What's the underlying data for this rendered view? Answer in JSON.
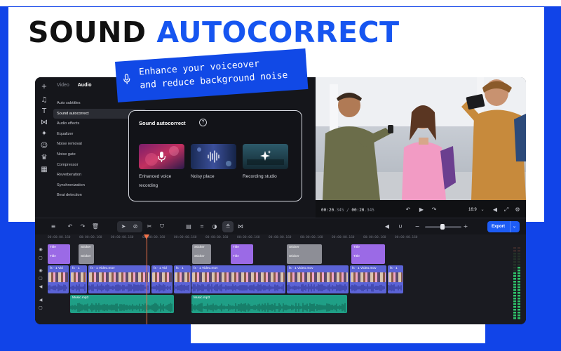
{
  "headline": {
    "word1": "SOUND",
    "word2": "AUTOCORRECT"
  },
  "callout": {
    "line1": "Enhance your voiceover",
    "line2": "and reduce background noise"
  },
  "left_panel": {
    "tabs": [
      {
        "label": "Video"
      },
      {
        "label": "Audio"
      }
    ],
    "menu": [
      {
        "label": "Auto subtitles"
      },
      {
        "label": "Sound autocorrect"
      },
      {
        "label": "Audio effects"
      },
      {
        "label": "Equalizer"
      },
      {
        "label": "Noise removal"
      },
      {
        "label": "Noise gate"
      },
      {
        "label": "Compressor"
      },
      {
        "label": "Reverberation"
      },
      {
        "label": "Synchronization"
      },
      {
        "label": "Beat detection"
      }
    ]
  },
  "sound_autocorrect": {
    "title": "Sound autocorrect",
    "help_icon": "?",
    "options": [
      {
        "label_line1": "Enhanced voice",
        "label_line2": "recording",
        "icon": "microphone-icon"
      },
      {
        "label_line1": "Noisy place",
        "label_line2": "",
        "icon": "waveform-icon"
      },
      {
        "label_line1": "Recording studio",
        "label_line2": "",
        "icon": "sparkle-icon"
      }
    ]
  },
  "preview": {
    "current_time": "00:20",
    "current_ms": ".345",
    "separator": " / ",
    "total_time": "00:20",
    "total_ms": ".345",
    "aspect_ratio": "16:9"
  },
  "toolbar": {
    "export_label": "Export"
  },
  "timeline": {
    "ruler": [
      "00:00:00.160",
      "00:00:00.160",
      "00:00:00.160",
      "00:00:00.160",
      "00:00:00.160",
      "00:00:00.160",
      "00:00:00.160",
      "00:00:00.160",
      "00:00:00.160",
      "00:00:00.160",
      "00:00:00.160",
      "00:00:00.160"
    ],
    "title_clips": [
      {
        "top": "Title",
        "bottom": "Title"
      },
      {
        "top": "Title",
        "bottom": "Title"
      },
      {
        "top": "Title",
        "bottom": "Title"
      }
    ],
    "sticker_clips": [
      {
        "top": "Sticker",
        "bottom": "Sticker"
      },
      {
        "top": "Sticker",
        "bottom": "Sticker"
      },
      {
        "top": "Sticker",
        "bottom": "Sticker"
      }
    ],
    "video_clips": [
      {
        "label": "fx · 1  Vid"
      },
      {
        "label": "fx · 1"
      },
      {
        "label": "fx · 1  Video.mov"
      },
      {
        "label": "fx · 1  Vid"
      },
      {
        "label": "fx · 1"
      },
      {
        "label": "fx · 1  Video.mov"
      },
      {
        "label": "fx · 1  Video.mov"
      },
      {
        "label": "fx · 1  Video.mov"
      },
      {
        "label": "fx · 1"
      }
    ],
    "music_clips": [
      {
        "label": "Music.mp3"
      },
      {
        "label": "Music.mp3"
      }
    ]
  },
  "colors": {
    "brand_blue": "#1149e6",
    "export_blue": "#1d5cf5",
    "title_clip": "#9b6ae6",
    "sticker_clip": "#8d8e96",
    "video_clip": "#5b63d6",
    "music_clip": "#1f9f86",
    "playhead": "#f2734a"
  }
}
